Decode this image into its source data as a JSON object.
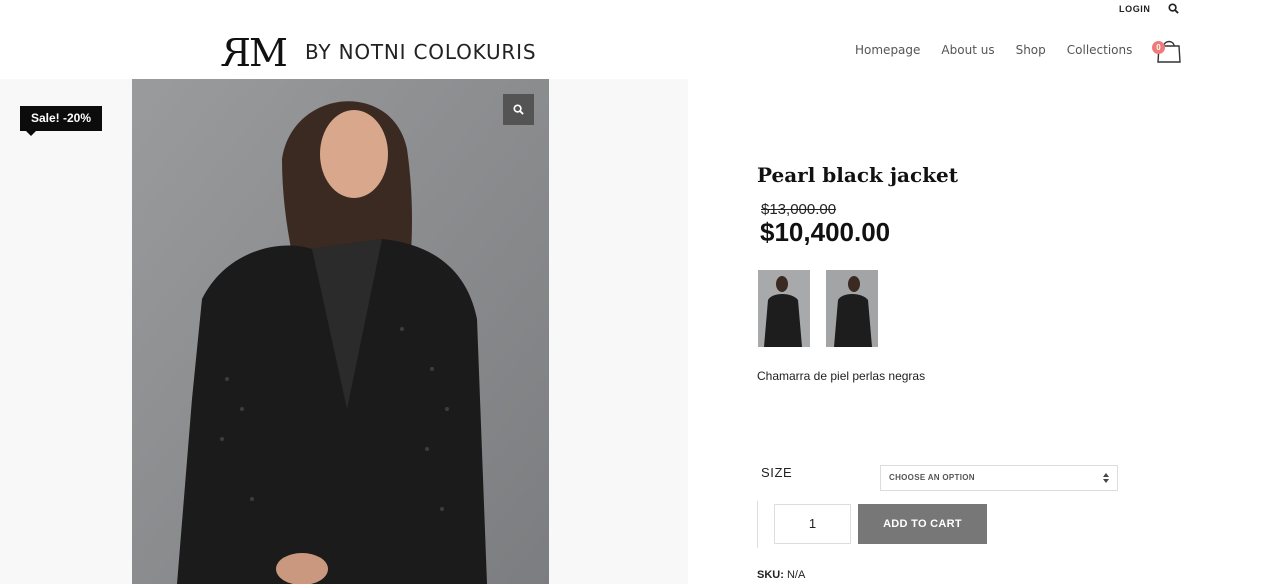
{
  "topbar": {
    "login": "LOGIN",
    "search_icon": "search-icon"
  },
  "header": {
    "logo_mark": "ЯM",
    "logo_text": "BY NOTNI COLOKURIS",
    "nav": [
      "Homepage",
      "About us",
      "Shop",
      "Collections"
    ],
    "cart_count": "0",
    "cart_icon": "shopping-bag-icon"
  },
  "gallery": {
    "sale_badge": "Sale! -20%",
    "zoom_icon": "magnifier-icon"
  },
  "product": {
    "title": "Pearl black jacket",
    "old_price": "$13,000.00",
    "new_price": "$10,400.00",
    "description": "Chamarra de piel perlas negras",
    "size_label": "SIZE",
    "size_placeholder": "CHOOSE AN OPTION",
    "quantity": "1",
    "add_to_cart": "ADD TO CART",
    "sku_label": "SKU:",
    "sku_value": "N/A"
  },
  "colors": {
    "sale_badge_bg": "#0c0c0c",
    "cart_badge": "#f07a7a",
    "add_to_cart_bg": "#777777",
    "gallery_bg": "#f8f8f8"
  }
}
